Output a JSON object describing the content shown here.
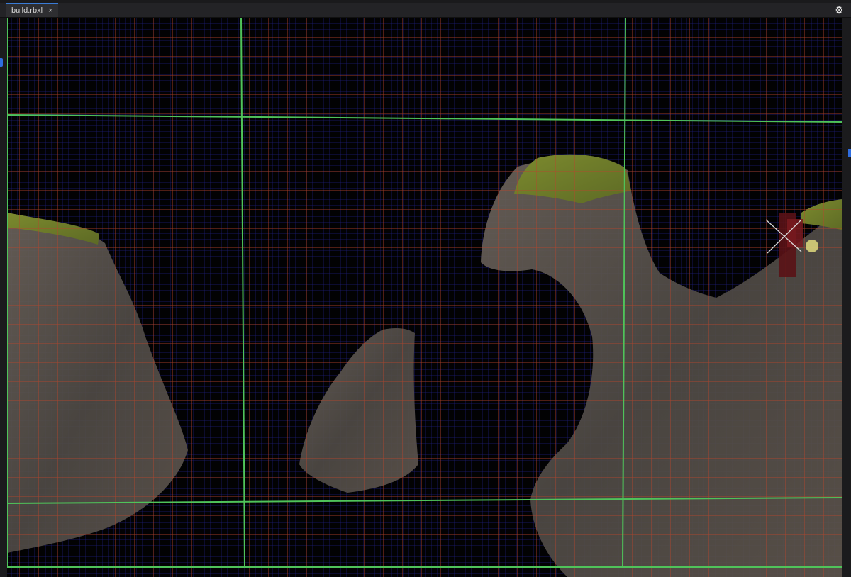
{
  "tab": {
    "title": "build.rbxl",
    "close_label": "×"
  },
  "toolbar": {
    "settings_icon": "gear-icon"
  },
  "viewport": {
    "grid_colors": {
      "minor": "#1e1e7a",
      "mid": "#b8452c",
      "major": "#4fc35a"
    },
    "terrain_colors": {
      "rock": "#5a534c",
      "moss": "#6e7a2c"
    }
  },
  "character": {
    "icon": "avatar-icon"
  }
}
